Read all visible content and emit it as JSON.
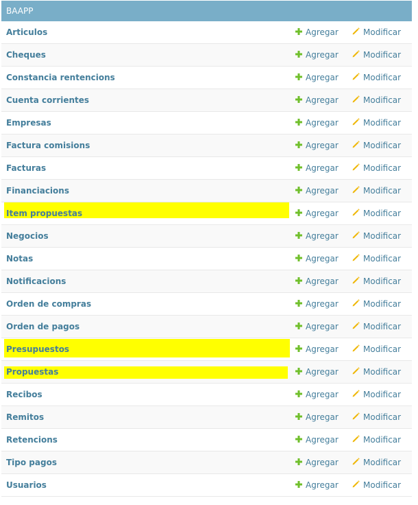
{
  "app": {
    "caption": "BAAPP",
    "add_label": "Agregar",
    "change_label": "Modificar",
    "colors": {
      "caption_bg": "#79aec8",
      "link": "#447e9b",
      "add_icon": "#70bf2b",
      "change_icon": "#efb80b",
      "highlight": "#ffff00"
    },
    "models": [
      {
        "name": "Articulos",
        "highlighted": false
      },
      {
        "name": "Cheques",
        "highlighted": false
      },
      {
        "name": "Constancia rentencions",
        "highlighted": false
      },
      {
        "name": "Cuenta corrientes",
        "highlighted": false
      },
      {
        "name": "Empresas",
        "highlighted": false
      },
      {
        "name": "Factura comisions",
        "highlighted": false
      },
      {
        "name": "Facturas",
        "highlighted": false
      },
      {
        "name": "Financiacions",
        "highlighted": false
      },
      {
        "name": "Item propuestas",
        "highlighted": true
      },
      {
        "name": "Negocios",
        "highlighted": false
      },
      {
        "name": "Notas",
        "highlighted": false
      },
      {
        "name": "Notificacions",
        "highlighted": false
      },
      {
        "name": "Orden de compras",
        "highlighted": false
      },
      {
        "name": "Orden de pagos",
        "highlighted": false
      },
      {
        "name": "Presupuestos",
        "highlighted": true
      },
      {
        "name": "Propuestas",
        "highlighted": true
      },
      {
        "name": "Recibos",
        "highlighted": false
      },
      {
        "name": "Remitos",
        "highlighted": false
      },
      {
        "name": "Retencions",
        "highlighted": false
      },
      {
        "name": "Tipo pagos",
        "highlighted": false
      },
      {
        "name": "Usuarios",
        "highlighted": false
      }
    ]
  }
}
